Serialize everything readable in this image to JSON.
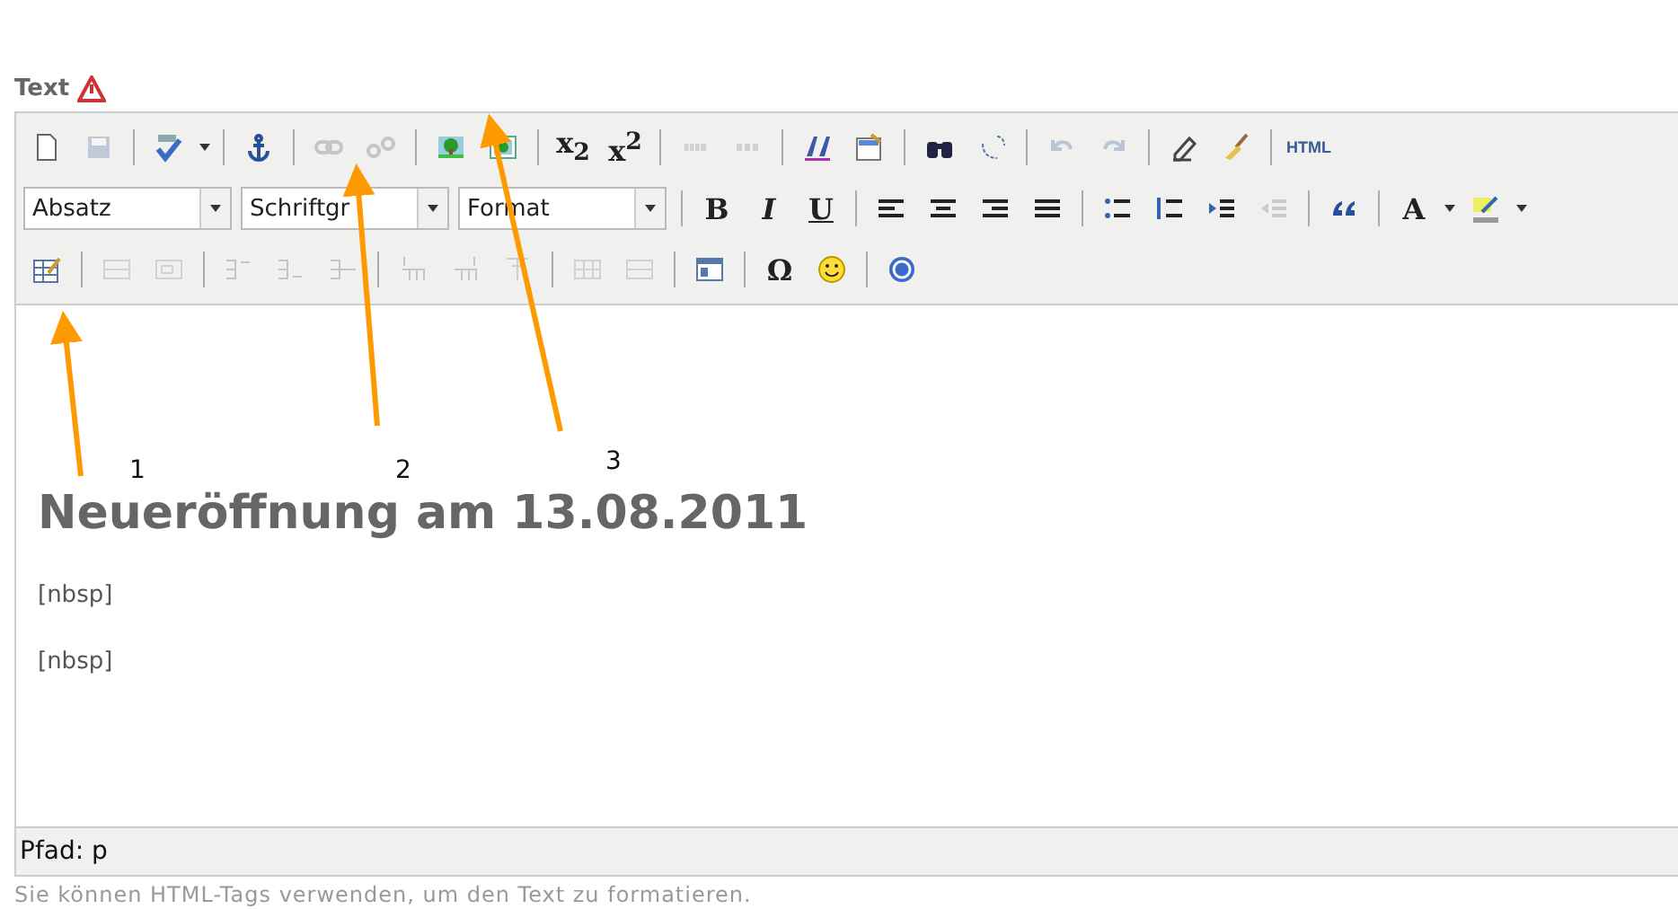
{
  "field_label": "Text",
  "toolbar": [
    [
      {
        "kind": "icon",
        "disabled": false
      },
      {
        "kind": "icon",
        "disabled": true
      },
      {
        "kind": "sep"
      },
      {
        "kind": "icon",
        "disabled": false
      },
      {
        "kind": "caret"
      },
      {
        "kind": "sep"
      },
      {
        "kind": "icon",
        "disabled": false
      },
      {
        "kind": "sep"
      },
      {
        "kind": "icon",
        "disabled": true
      },
      {
        "kind": "icon",
        "disabled": true
      },
      {
        "kind": "sep"
      },
      {
        "kind": "icon",
        "disabled": false
      },
      {
        "kind": "icon",
        "disabled": false
      },
      {
        "kind": "sep"
      },
      {
        "kind": "letter",
        "label": "x$_{2}$",
        "disabled": false
      },
      {
        "kind": "letter",
        "label": "x$^{2}$",
        "disabled": false
      },
      {
        "kind": "sep"
      },
      {
        "kind": "icon",
        "disabled": true
      },
      {
        "kind": "icon",
        "disabled": true
      },
      {
        "kind": "sep"
      },
      {
        "kind": "icon",
        "disabled": false
      },
      {
        "kind": "icon",
        "disabled": false
      },
      {
        "kind": "sep"
      },
      {
        "kind": "icon",
        "disabled": false
      },
      {
        "kind": "icon",
        "disabled": false
      },
      {
        "kind": "sep"
      },
      {
        "kind": "icon",
        "disabled": true
      },
      {
        "kind": "icon",
        "disabled": true
      },
      {
        "kind": "sep"
      },
      {
        "kind": "icon",
        "disabled": false
      },
      {
        "kind": "icon",
        "disabled": false
      },
      {
        "kind": "sep"
      },
      {
        "kind": "small",
        "label": "HTML",
        "disabled": false
      }
    ],
    [
      {
        "kind": "select",
        "label": "Absatz"
      },
      {
        "kind": "select",
        "label": "Schriftgr"
      },
      {
        "kind": "select",
        "label": "Format"
      },
      {
        "kind": "sep"
      },
      {
        "kind": "letter",
        "label": "B",
        "disabled": false
      },
      {
        "kind": "letter",
        "label": "I",
        "disabled": false
      },
      {
        "kind": "letter",
        "label": "U",
        "disabled": false
      },
      {
        "kind": "sep"
      },
      {
        "kind": "icon",
        "disabled": false
      },
      {
        "kind": "icon",
        "disabled": false
      },
      {
        "kind": "icon",
        "disabled": false
      },
      {
        "kind": "icon",
        "disabled": false
      },
      {
        "kind": "sep"
      },
      {
        "kind": "icon",
        "disabled": false
      },
      {
        "kind": "icon",
        "disabled": false
      },
      {
        "kind": "icon",
        "disabled": false
      },
      {
        "kind": "icon",
        "disabled": true
      },
      {
        "kind": "sep"
      },
      {
        "kind": "icon",
        "disabled": false
      },
      {
        "kind": "sep"
      },
      {
        "kind": "letter",
        "label": "A",
        "disabled": false
      },
      {
        "kind": "caret"
      },
      {
        "kind": "icon",
        "disabled": false
      },
      {
        "kind": "caret"
      }
    ],
    [
      {
        "kind": "icon",
        "disabled": false
      },
      {
        "kind": "sep"
      },
      {
        "kind": "icon",
        "disabled": true
      },
      {
        "kind": "icon",
        "disabled": true
      },
      {
        "kind": "sep"
      },
      {
        "kind": "icon",
        "disabled": true
      },
      {
        "kind": "icon",
        "disabled": true
      },
      {
        "kind": "icon",
        "disabled": true
      },
      {
        "kind": "sep"
      },
      {
        "kind": "icon",
        "disabled": true
      },
      {
        "kind": "icon",
        "disabled": true
      },
      {
        "kind": "icon",
        "disabled": true
      },
      {
        "kind": "sep"
      },
      {
        "kind": "icon",
        "disabled": true
      },
      {
        "kind": "icon",
        "disabled": true
      },
      {
        "kind": "sep"
      },
      {
        "kind": "icon",
        "disabled": false
      },
      {
        "kind": "sep"
      },
      {
        "kind": "letter",
        "label": "Ω",
        "disabled": false
      },
      {
        "kind": "icon",
        "disabled": false
      },
      {
        "kind": "sep"
      },
      {
        "kind": "icon",
        "disabled": false
      }
    ]
  ],
  "content": [
    {
      "kind": "heading",
      "text": "Neueröffnung am 13.08.2011"
    },
    {
      "kind": "paragraph",
      "text": "[nbsp]"
    },
    {
      "kind": "paragraph",
      "text": "[nbsp]"
    }
  ],
  "status_bar": "Pfad: p",
  "hint": "Sie können HTML-Tags verwenden, um den Text zu formatieren.",
  "annotations": [
    {
      "label": "1"
    },
    {
      "label": "2"
    },
    {
      "label": "3"
    }
  ]
}
